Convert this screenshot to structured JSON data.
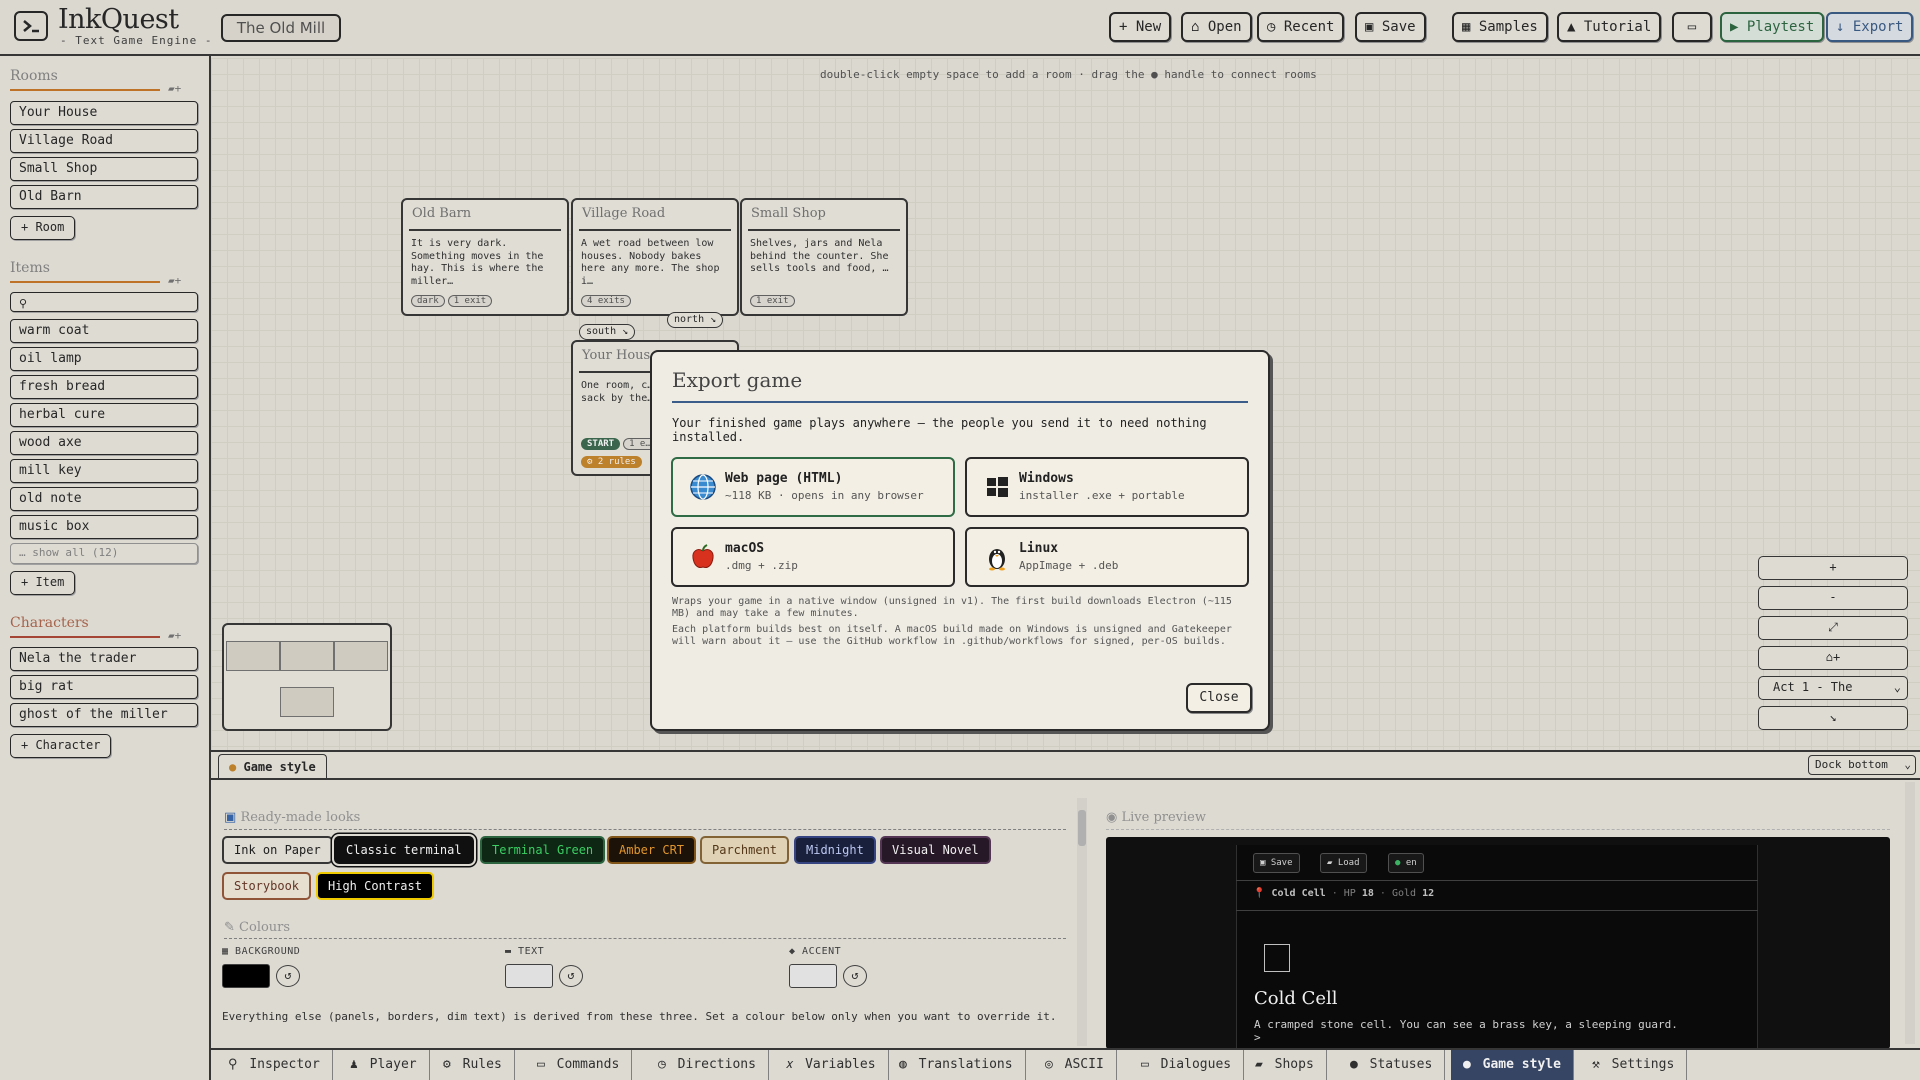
{
  "app": {
    "title": "InkQuest",
    "subtitle": "- Text Game Engine -",
    "project": "The Old Mill"
  },
  "toolbar": {
    "new": "+ New",
    "open": "⌂ Open",
    "recent": "◷ Recent",
    "save": "▣ Save",
    "samples": "▦ Samples",
    "tutorial": "▲ Tutorial",
    "panel": "▭",
    "playtest": "▶ Playtest",
    "export": "↓ Export"
  },
  "sidebar": {
    "rooms_title": "Rooms",
    "rooms": [
      "Your House",
      "Village Road",
      "Small Shop",
      "Old Barn"
    ],
    "add_room": "+ Room",
    "items_title": "Items",
    "items_search_placeholder": "",
    "items": [
      "warm coat",
      "oil lamp",
      "fresh bread",
      "herbal cure",
      "wood axe",
      "mill key",
      "old note",
      "music box"
    ],
    "items_show_all": "… show all (12)",
    "add_item": "+ Item",
    "characters_title": "Characters",
    "characters": [
      "Nela the trader",
      "big rat",
      "ghost of the miller"
    ],
    "add_character": "+ Character"
  },
  "canvas": {
    "hint": "double-click empty space to add a room · drag the ● handle to connect rooms",
    "rooms": [
      {
        "title": "Old Barn",
        "desc": "It is very dark. Something moves in the hay. This is where the miller…",
        "tags": [
          "dark",
          "1 exit"
        ]
      },
      {
        "title": "Village Road",
        "desc": "A wet road between low houses. Nobody bakes here any more. The shop i…",
        "tags": [
          "4 exits"
        ]
      },
      {
        "title": "Small Shop",
        "desc": "Shelves, jars and Nela behind the counter. She sells tools and food, …",
        "tags": [
          "1 exit"
        ]
      },
      {
        "title": "Your House",
        "desc": "One room, c… cold stove… sack by the… bee…",
        "tags": [
          "START",
          "1 e…"
        ],
        "rules": "⚙ 2 rules"
      }
    ],
    "exits": {
      "south": "south ↘",
      "north": "north ↘"
    },
    "controls": [
      "+",
      "-",
      "⤢",
      "⌂+",
      "↘"
    ],
    "act_select": "Act 1 - The"
  },
  "export_dialog": {
    "title": "Export game",
    "intro": "Your finished game plays anywhere — the people you send it to need nothing installed.",
    "options": [
      {
        "name": "Web page (HTML)",
        "sub": "~118 KB · opens in any browser",
        "icon": "globe-icon"
      },
      {
        "name": "Windows",
        "sub": "installer .exe + portable",
        "icon": "windows-icon"
      },
      {
        "name": "macOS",
        "sub": ".dmg + .zip",
        "icon": "apple-icon"
      },
      {
        "name": "Linux",
        "sub": "AppImage + .deb",
        "icon": "penguin-icon"
      }
    ],
    "note1": "Wraps your game in a native window (unsigned in v1). The first build downloads Electron (~115 MB) and may take a few minutes.",
    "note2": "Each platform builds best on itself. A macOS build made on Windows is unsigned and Gatekeeper will warn about it — use the GitHub workflow in .github/workflows for signed, per-OS builds.",
    "close": "Close"
  },
  "panel": {
    "tab": "Game style",
    "dock": "Dock bottom",
    "looks_title": "Ready-made looks",
    "looks": [
      {
        "label": "Ink on Paper",
        "bg": "#ece9e1",
        "fg": "#222222",
        "border": "#3a3a3a"
      },
      {
        "label": "Classic terminal",
        "bg": "#111111",
        "fg": "#ffffff",
        "border": "#111111"
      },
      {
        "label": "Terminal Green",
        "bg": "#0f2a16",
        "fg": "#3fdc6a",
        "border": "#2f6b45"
      },
      {
        "label": "Amber CRT",
        "bg": "#1f1408",
        "fg": "#f0a030",
        "border": "#8a5a1a"
      },
      {
        "label": "Parchment",
        "bg": "#efe0c0",
        "fg": "#5a3a1a",
        "border": "#8a6a3a"
      },
      {
        "label": "Midnight",
        "bg": "#1a2240",
        "fg": "#c8d4ff",
        "border": "#3a4a8a"
      },
      {
        "label": "Visual Novel",
        "bg": "#2a1a2a",
        "fg": "#ffffff",
        "border": "#5a3a5a"
      },
      {
        "label": "Storybook",
        "bg": "#f5ecdc",
        "fg": "#6a3a2a",
        "border": "#9a5a3a"
      },
      {
        "label": "High Contrast",
        "bg": "#000000",
        "fg": "#ffffff",
        "border": "#ffd700"
      }
    ],
    "colours_title": "Colours",
    "background_label": "BACKGROUND",
    "text_label": "TEXT",
    "accent_label": "ACCENT",
    "background_color": "#000000",
    "text_color": "#eeeeee",
    "accent_color": "#f0f0f0",
    "colours_note": "Everything else (panels, borders, dim text) is derived from these three. Set a colour below only when you want to override it.",
    "preview_title": "Live preview",
    "preview": {
      "save": "Save",
      "load": "Load",
      "lang": "en",
      "location": "Cold Cell",
      "hp_label": "HP",
      "hp": "18",
      "gold_label": "Gold",
      "gold": "12",
      "heading": "Cold Cell",
      "text": "A cramped stone cell. You can see a brass key, a sleeping guard.",
      "prompt": ">"
    }
  },
  "bottom_tabs": [
    "Inspector",
    "Player",
    "Rules",
    "Commands",
    "Directions",
    "Variables",
    "Translations",
    "ASCII",
    "Dialogues",
    "Shops",
    "Statuses",
    "Game style",
    "Settings"
  ]
}
